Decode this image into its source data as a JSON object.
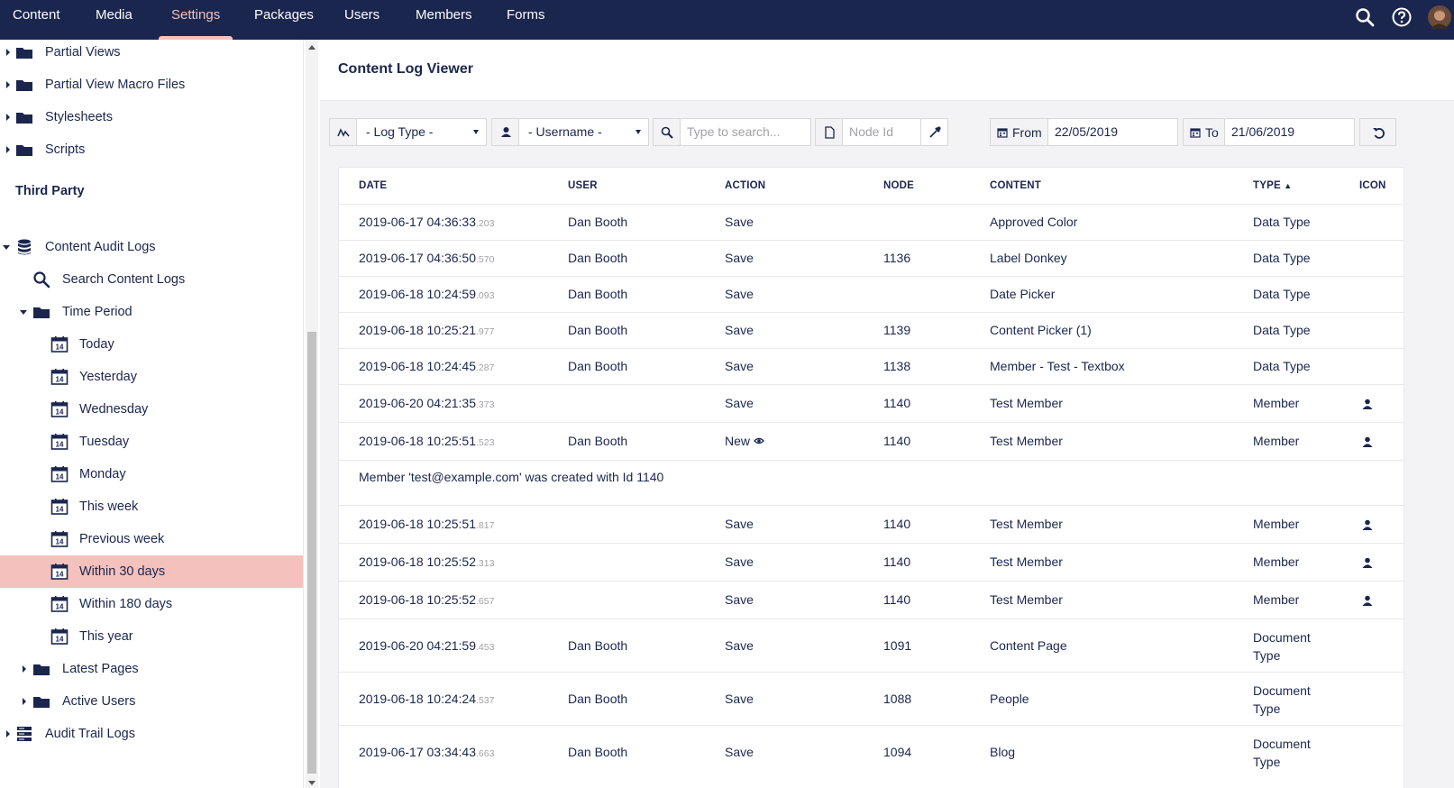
{
  "nav": {
    "items": [
      "Content",
      "Media",
      "Settings",
      "Packages",
      "Users",
      "Members",
      "Forms"
    ],
    "active": "Settings"
  },
  "sidebar": {
    "top_items": [
      "Partial Views",
      "Partial View Macro Files",
      "Stylesheets",
      "Scripts"
    ],
    "section_title": "Third Party",
    "audit": {
      "label": "Content Audit Logs",
      "search": "Search Content Logs",
      "time_period": "Time Period",
      "periods": [
        "Today",
        "Yesterday",
        "Wednesday",
        "Tuesday",
        "Monday",
        "This week",
        "Previous week",
        "Within 30 days",
        "Within 180 days",
        "This year"
      ],
      "calendar_number": "14",
      "selected": "Within 30 days",
      "latest_pages": "Latest Pages",
      "active_users": "Active Users"
    },
    "audit_trail": "Audit Trail Logs"
  },
  "main": {
    "title": "Content Log Viewer",
    "filters": {
      "log_type": "- Log Type -",
      "username": "- Username -",
      "search_placeholder": "Type to search...",
      "node_placeholder": "Node Id",
      "from_label": "From",
      "from_value": "22/05/2019",
      "to_label": "To",
      "to_value": "21/06/2019"
    },
    "columns": [
      "DATE",
      "USER",
      "ACTION",
      "NODE",
      "CONTENT",
      "TYPE",
      "ICON"
    ],
    "sorted_column": "TYPE",
    "rows": [
      {
        "date": "2019-06-17 04:36:33",
        "ms": ".203",
        "user": "Dan Booth",
        "action": "Save",
        "node": "",
        "content": "Approved Color",
        "type": "Data Type",
        "icon": false
      },
      {
        "date": "2019-06-17 04:36:50",
        "ms": ".570",
        "user": "Dan Booth",
        "action": "Save",
        "node": "1136",
        "content": "Label Donkey",
        "type": "Data Type",
        "icon": false
      },
      {
        "date": "2019-06-18 10:24:59",
        "ms": ".093",
        "user": "Dan Booth",
        "action": "Save",
        "node": "",
        "content": "Date Picker",
        "type": "Data Type",
        "icon": false
      },
      {
        "date": "2019-06-18 10:25:21",
        "ms": ".977",
        "user": "Dan Booth",
        "action": "Save",
        "node": "1139",
        "content": "Content Picker (1)",
        "type": "Data Type",
        "icon": false
      },
      {
        "date": "2019-06-18 10:24:45",
        "ms": ".287",
        "user": "Dan Booth",
        "action": "Save",
        "node": "1138",
        "content": "Member - Test - Textbox",
        "type": "Data Type",
        "icon": false
      },
      {
        "date": "2019-06-20 04:21:35",
        "ms": ".373",
        "user": "",
        "action": "Save",
        "node": "1140",
        "content": "Test Member",
        "type": "Member",
        "icon": true
      },
      {
        "date": "2019-06-18 10:25:51",
        "ms": ".523",
        "user": "Dan Booth",
        "action": "New",
        "node": "1140",
        "content": "Test Member",
        "type": "Member",
        "icon": true
      },
      {
        "date": "2019-06-18 10:25:51",
        "ms": ".817",
        "user": "",
        "action": "Save",
        "node": "1140",
        "content": "Test Member",
        "type": "Member",
        "icon": true
      },
      {
        "date": "2019-06-18 10:25:52",
        "ms": ".313",
        "user": "",
        "action": "Save",
        "node": "1140",
        "content": "Test Member",
        "type": "Member",
        "icon": true
      },
      {
        "date": "2019-06-18 10:25:52",
        "ms": ".657",
        "user": "",
        "action": "Save",
        "node": "1140",
        "content": "Test Member",
        "type": "Member",
        "icon": true
      },
      {
        "date": "2019-06-20 04:21:59",
        "ms": ".453",
        "user": "Dan Booth",
        "action": "Save",
        "node": "1091",
        "content": "Content Page",
        "type": "Document Type",
        "icon": false
      },
      {
        "date": "2019-06-18 10:24:24",
        "ms": ".537",
        "user": "Dan Booth",
        "action": "Save",
        "node": "1088",
        "content": "People",
        "type": "Document Type",
        "icon": false
      },
      {
        "date": "2019-06-17 03:34:43",
        "ms": ".663",
        "user": "Dan Booth",
        "action": "Save",
        "node": "1094",
        "content": "Blog",
        "type": "Document Type",
        "icon": false
      }
    ],
    "comment": "Member 'test@example.com' was created with Id 1140"
  }
}
